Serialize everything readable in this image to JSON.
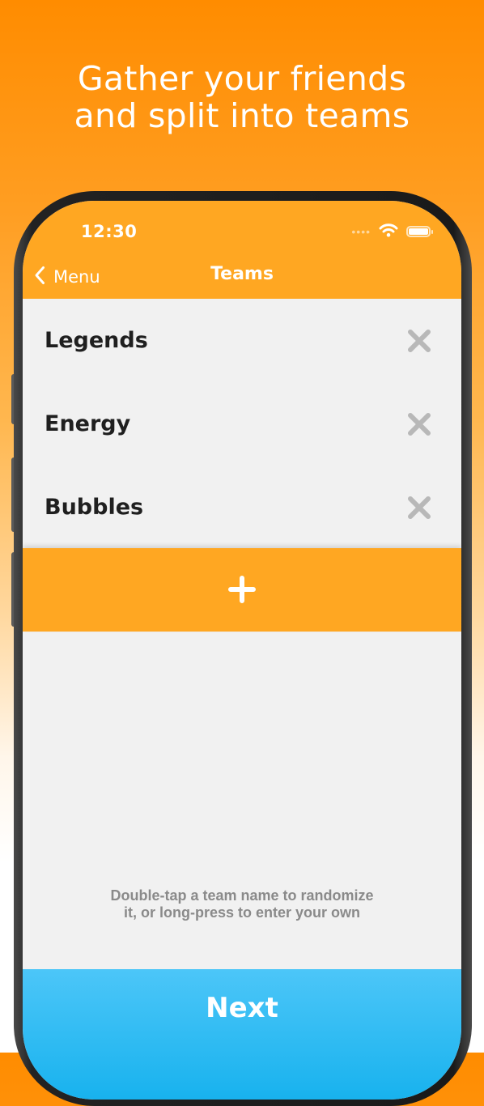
{
  "promo": {
    "headline_line1": "Gather your friends",
    "headline_line2": "and split into teams"
  },
  "status_bar": {
    "time": "12:30",
    "icons": [
      "cellular-dots-icon",
      "wifi-icon",
      "battery-icon"
    ]
  },
  "nav": {
    "back_label": "Menu",
    "title": "Teams"
  },
  "teams": [
    {
      "name": "Legends"
    },
    {
      "name": "Energy"
    },
    {
      "name": "Bubbles"
    }
  ],
  "add_button": {
    "icon": "plus-icon"
  },
  "hint": {
    "line1": "Double-tap a team name to randomize",
    "line2": "it, or long-press to enter your own"
  },
  "next_button": {
    "label": "Next"
  },
  "colors": {
    "accent_orange": "#ffa722",
    "next_blue": "#18b2ee",
    "list_background": "#f1f1f1",
    "remove_icon_gray": "#b8b8b8"
  }
}
